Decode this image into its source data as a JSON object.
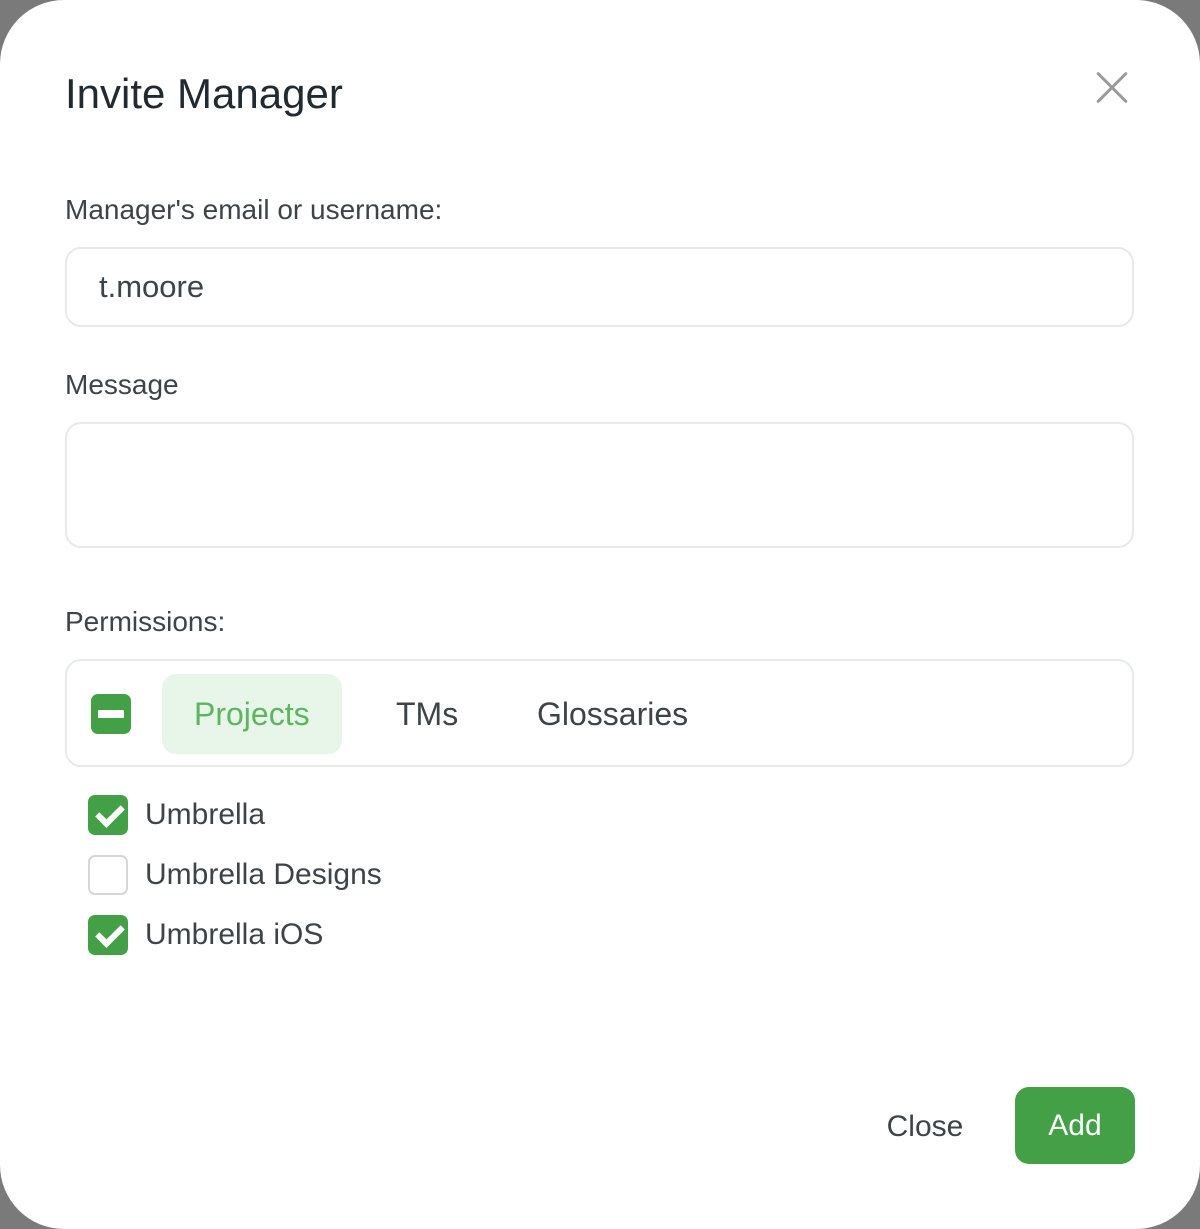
{
  "dialog": {
    "title": "Invite Manager",
    "close_icon": "close-icon"
  },
  "email": {
    "label": "Manager's email or username:",
    "value": "t.moore",
    "placeholder": ""
  },
  "message": {
    "label": "Message",
    "value": "",
    "placeholder": ""
  },
  "permissions": {
    "label": "Permissions:",
    "select_all_state": "indeterminate",
    "tabs": [
      {
        "label": "Projects",
        "active": true
      },
      {
        "label": "TMs",
        "active": false
      },
      {
        "label": "Glossaries",
        "active": false
      }
    ],
    "items": [
      {
        "label": "Umbrella",
        "checked": true
      },
      {
        "label": "Umbrella Designs",
        "checked": false
      },
      {
        "label": "Umbrella iOS",
        "checked": true
      }
    ]
  },
  "footer": {
    "close_label": "Close",
    "add_label": "Add"
  },
  "colors": {
    "accent": "#43a047",
    "accent_light": "#e8f5e9"
  }
}
